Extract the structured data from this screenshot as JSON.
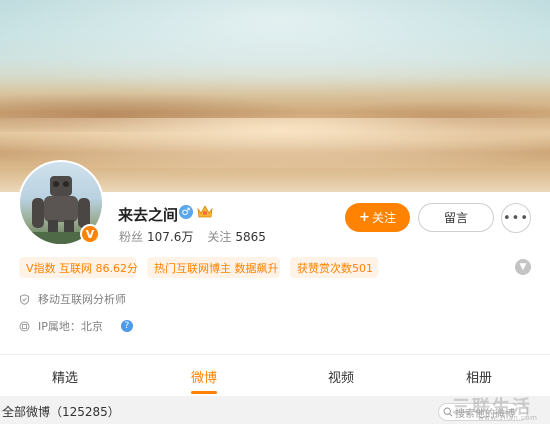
{
  "profile": {
    "name": "来去之间",
    "gender_icon": "male-icon",
    "vip_icon": "crown-icon",
    "verify_badge": "V",
    "stats": {
      "fans_label": "粉丝",
      "fans_value": "107.6万",
      "following_label": "关注",
      "following_value": "5865"
    }
  },
  "actions": {
    "follow_plus": "+",
    "follow_label": "关注",
    "message_label": "留言",
    "more_label": "•••"
  },
  "tags": [
    {
      "label": "V指数 互联网 86.62分"
    },
    {
      "label": "热门互联网博主 数据飙升"
    },
    {
      "label": "获赞赏次数501"
    }
  ],
  "info": {
    "job": "移动互联网分析师",
    "ip_label": "IP属地：北京",
    "help_glyph": "?"
  },
  "tabs": [
    {
      "label": "精选",
      "active": false
    },
    {
      "label": "微博",
      "active": true
    },
    {
      "label": "视频",
      "active": false
    },
    {
      "label": "相册",
      "active": false
    }
  ],
  "feed": {
    "all_posts_label": "全部微博（125285）",
    "search_placeholder": "搜索他的微博"
  },
  "watermark": {
    "text": "三联生活",
    "url": "www.3lian.com"
  },
  "colors": {
    "accent": "#ff8200",
    "tag_bg": "#fff2e6",
    "link_blue": "#4c9ae8"
  }
}
